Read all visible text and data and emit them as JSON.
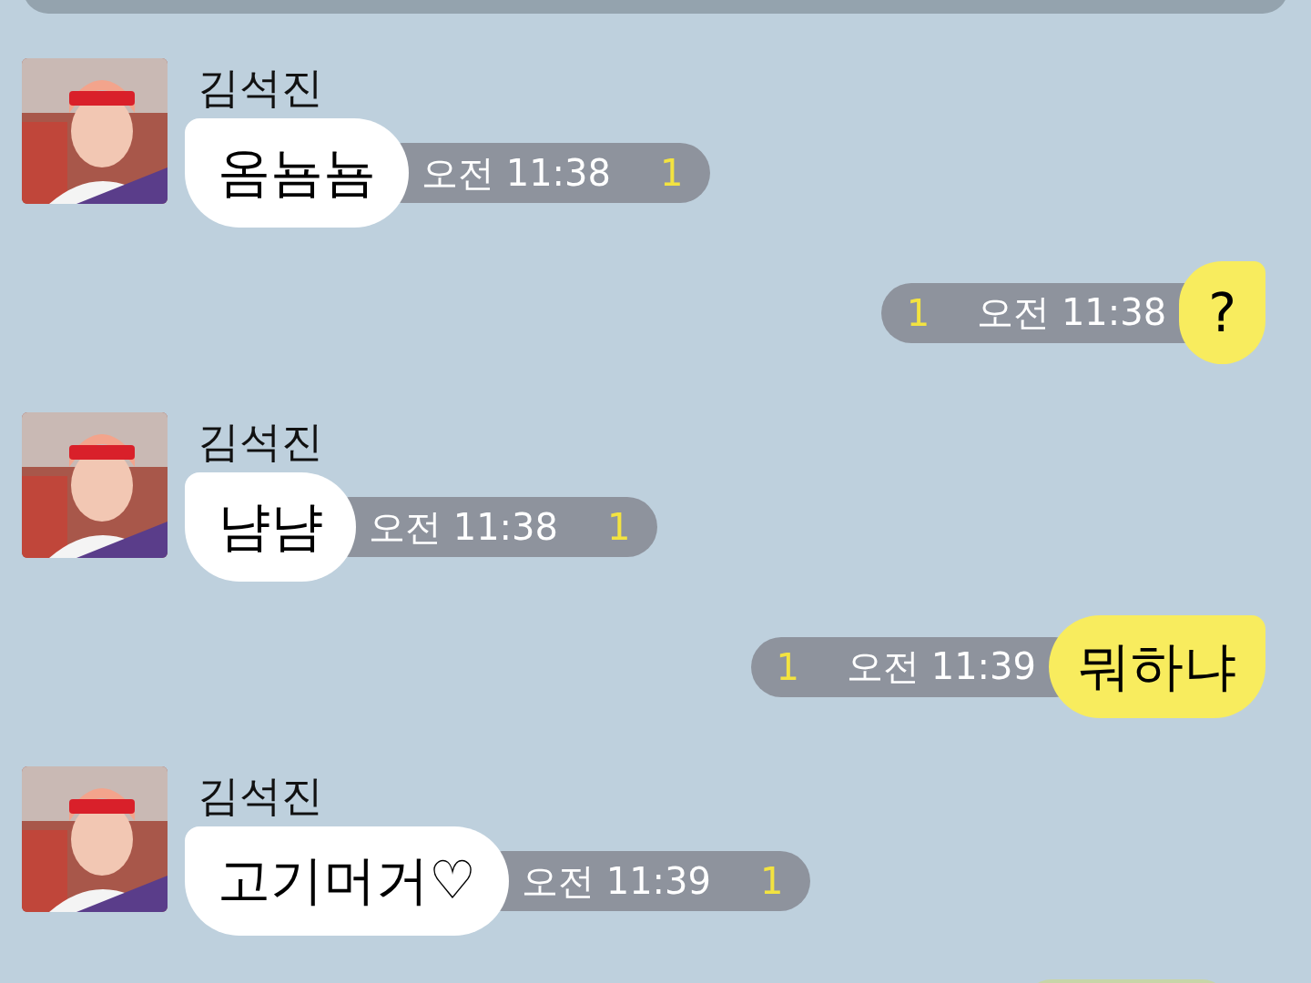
{
  "messages": [
    {
      "kind": "received",
      "sender": "김석진",
      "text": "옴뇸뇸",
      "time": "오전 11:38",
      "unread": "1"
    },
    {
      "kind": "sent",
      "text": "?",
      "time": "오전 11:38",
      "unread": "1"
    },
    {
      "kind": "received",
      "sender": "김석진",
      "text": "냠냠",
      "time": "오전 11:38",
      "unread": "1"
    },
    {
      "kind": "sent",
      "text": "뭐하냐",
      "time": "오전 11:39",
      "unread": "1"
    },
    {
      "kind": "received",
      "sender": "김석진",
      "text": "고기머거♡",
      "time": "오전 11:39",
      "unread": "1"
    }
  ]
}
